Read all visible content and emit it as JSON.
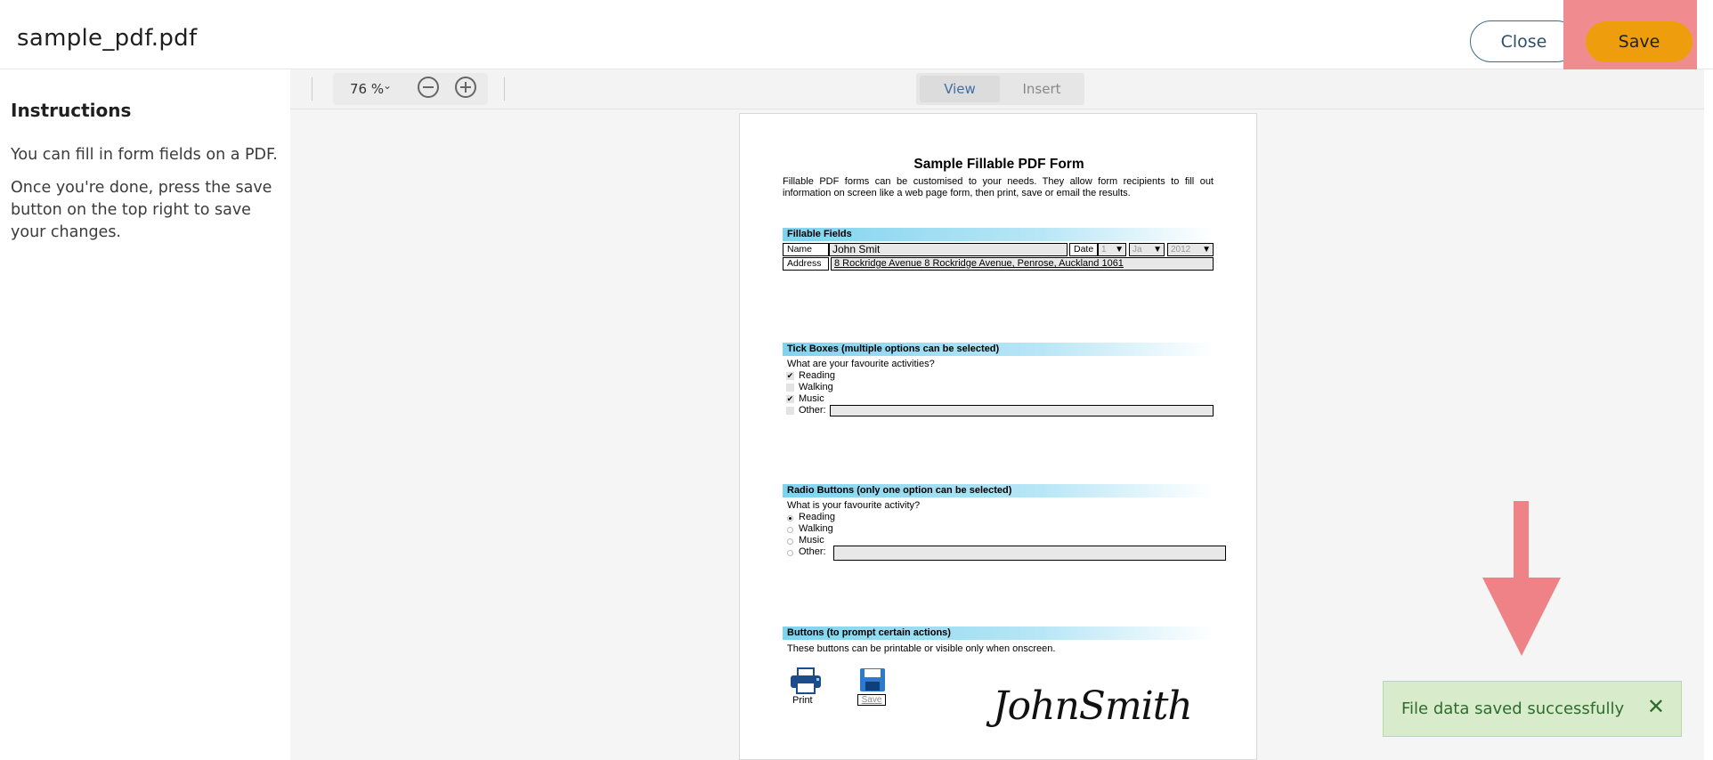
{
  "header": {
    "file_name": "sample_pdf.pdf",
    "close_label": "Close",
    "save_label": "Save"
  },
  "sidebar": {
    "title": "Instructions",
    "paragraph_1": "You can fill in form fields on a PDF.",
    "paragraph_2": "Once you're done, press the save button on the top right to save your changes."
  },
  "toolbar": {
    "zoom_value": "76 %",
    "zoom_chevron": "⌄",
    "modes": [
      "View",
      "Insert"
    ],
    "active_mode": "View"
  },
  "pdf": {
    "title": "Sample Fillable PDF Form",
    "intro": "Fillable PDF forms can be customised to your needs. They allow form recipients to fill out information on screen like a web page form, then print, save or email the results.",
    "fillable": {
      "heading": "Fillable Fields",
      "name_label": "Name",
      "name_value": "John Smit",
      "date_label": "Date",
      "day_value": "1",
      "month_value": "Ja",
      "year_value": "2012",
      "address_label": "Address",
      "address_value": "8 Rockridge Avenue 8 Rockridge Avenue, Penrose, Auckland 1061"
    },
    "tick": {
      "heading": "Tick Boxes (multiple options can be selected)",
      "question": "What are your favourite activities?",
      "options": [
        {
          "label": "Reading",
          "checked": true
        },
        {
          "label": "Walking",
          "checked": false
        },
        {
          "label": "Music",
          "checked": true
        },
        {
          "label": "Other:",
          "checked": false
        }
      ],
      "check_glyph": "✔"
    },
    "radio": {
      "heading": "Radio Buttons (only one option can be selected)",
      "question": "What is your favourite activity?",
      "options": [
        "Reading",
        "Walking",
        "Music",
        "Other:"
      ],
      "selected": "Reading"
    },
    "buttons": {
      "heading": "Buttons (to prompt certain actions)",
      "note": "These buttons can be printable or visible only when onscreen.",
      "print_label": "Print",
      "save_label": "Save"
    },
    "signature": "JohnSmith"
  },
  "toast": {
    "message": "File data saved successfully",
    "close_glyph": "✕",
    "background": "#d8eccb"
  },
  "colors": {
    "save_button": "#ee9e0d",
    "annotation": "#ee8287",
    "close_border": "#3b6a8f"
  }
}
